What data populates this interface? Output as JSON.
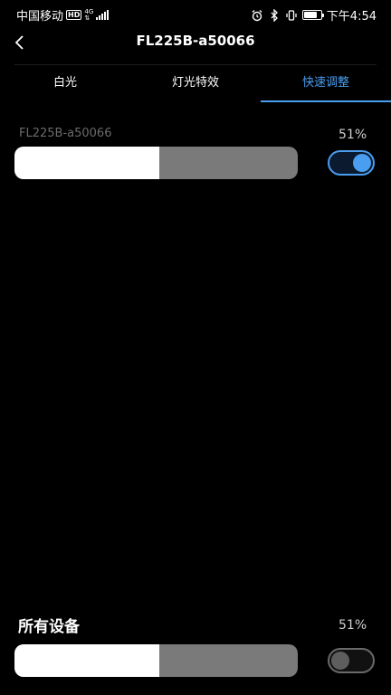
{
  "status_bar": {
    "carrier": "中国移动",
    "hd": "HD",
    "network": "4G",
    "time": "下午4:54",
    "battery_level": 0.8
  },
  "nav": {
    "title": "FL225B-a50066"
  },
  "tabs": [
    {
      "label": "白光",
      "active": false
    },
    {
      "label": "灯光特效",
      "active": false
    },
    {
      "label": "快速调整",
      "active": true
    }
  ],
  "device": {
    "name": "FL225B-a50066",
    "percent_text": "51%",
    "brightness": 0.51,
    "toggle_on": true
  },
  "all_devices": {
    "label": "所有设备",
    "percent_text": "51%",
    "brightness": 0.51,
    "toggle_on": false
  },
  "colors": {
    "accent": "#4a9ef0",
    "background": "#000000",
    "slider_track": "#7a7a7a"
  }
}
